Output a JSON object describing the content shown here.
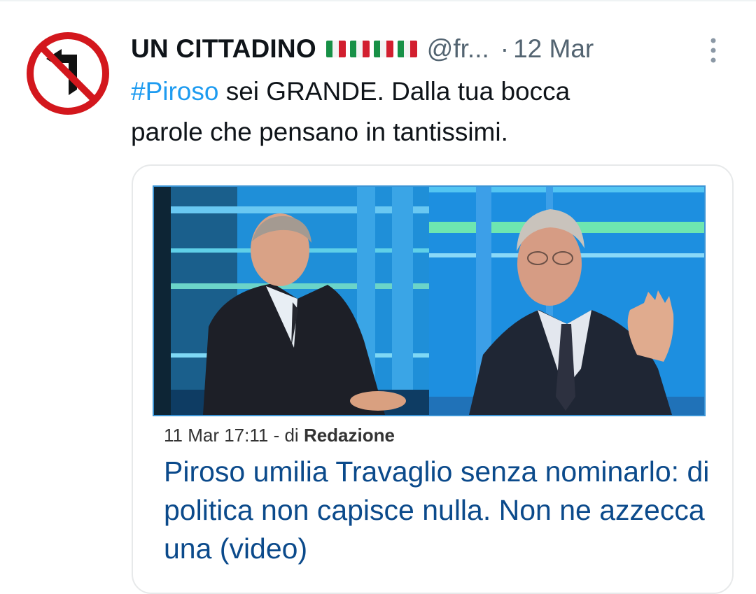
{
  "tweet": {
    "display_name": "UN CITTADINO",
    "flags_icon": "italy-flag-icon",
    "handle": "@fr...",
    "separator": "·",
    "date": "12 Mar",
    "text_hashtag": "#Piroso",
    "text_body_line1": " sei GRANDE. Dalla tua bocca",
    "text_body_line2": "parole che pensano in tantissimi."
  },
  "card": {
    "timestamp": "11 Mar 17:11",
    "byline_prefix": " - di ",
    "author": "Redazione",
    "headline": "Piroso umilia Travaglio senza nominarlo: di politica non capisce nulla. Non ne azzecca una (video)"
  },
  "colors": {
    "accent": "#1d9bf0",
    "headline": "#0b4a8b",
    "muted": "#536471",
    "studio_blue": "#1e90dd"
  }
}
